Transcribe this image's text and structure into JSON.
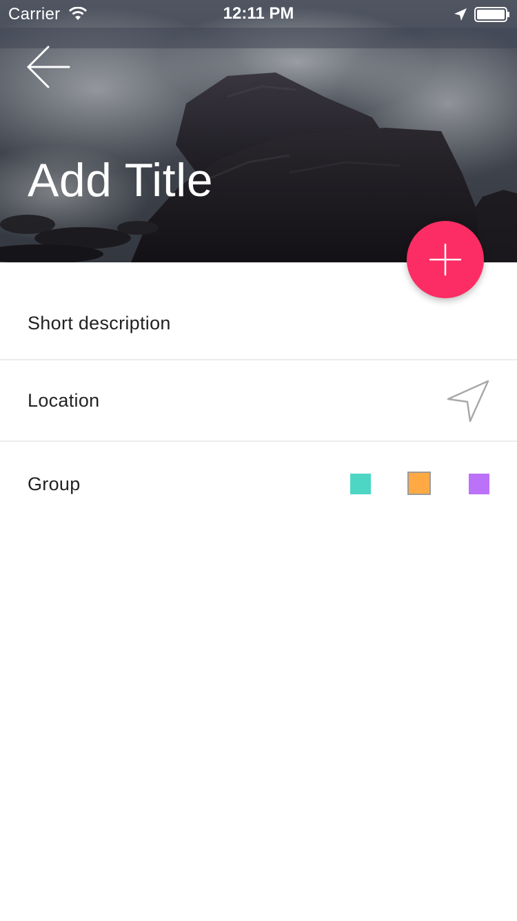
{
  "status_bar": {
    "carrier": "Carrier",
    "time": "12:11 PM"
  },
  "header": {
    "title": "Add Title",
    "back_icon": "arrow-left-icon"
  },
  "fab": {
    "icon": "plus-icon",
    "color": "#fc2d64"
  },
  "form": {
    "description_label": "Short description",
    "location_label": "Location",
    "location_icon": "navigation-arrow-icon",
    "group_label": "Group",
    "group_colors": [
      "#4dd6c3",
      "#fea944",
      "#bb72f8"
    ],
    "selected_group_index": 1
  }
}
